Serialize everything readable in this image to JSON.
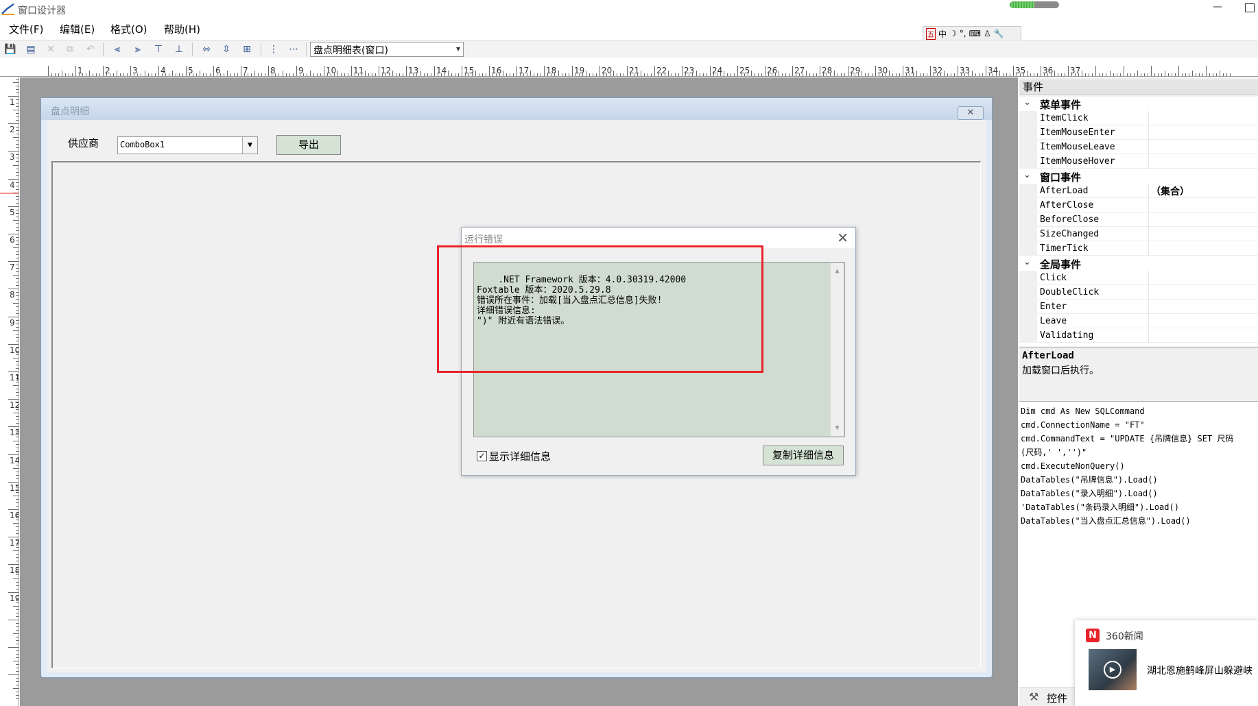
{
  "app": {
    "title": "窗口设计器"
  },
  "menu": [
    "文件(F)",
    "编辑(E)",
    "格式(O)",
    "帮助(H)"
  ],
  "ime": [
    "五",
    "中",
    "☽",
    "°,",
    "⌨",
    "♙",
    "🔧"
  ],
  "toolbar": {
    "form_select_value": "盘点明细表(窗口)"
  },
  "ruler": {
    "h_labels": [
      "1",
      "2",
      "3",
      "4",
      "5",
      "6",
      "7",
      "8",
      "9",
      "10",
      "11",
      "12",
      "13",
      "14",
      "15",
      "16",
      "17",
      "18",
      "19",
      "20",
      "21",
      "22",
      "23",
      "24",
      "25",
      "26",
      "27",
      "28",
      "29",
      "30",
      "31",
      "32",
      "33",
      "34",
      "35",
      "36",
      "37"
    ],
    "v_labels": [
      "1",
      "2",
      "3",
      "4",
      "5",
      "6",
      "7",
      "8",
      "9",
      "10",
      "11",
      "12",
      "13",
      "14",
      "15",
      "16",
      "17",
      "18",
      "19"
    ]
  },
  "design_form": {
    "caption": "盘点明细",
    "close_glyph": "✕",
    "supplier_label": "供应商",
    "combo_value": "ComboBox1",
    "export_label": "导出"
  },
  "error_dialog": {
    "title": "运行错误",
    "close_glyph": "✕",
    "details": ".NET Framework 版本：4.0.30319.42000\nFoxtable 版本：2020.5.29.8\n错误所在事件：加载[当入盘点汇总信息]失败!\n详细错误信息:\n\")\" 附近有语法错误。",
    "show_detail_label": "显示详细信息",
    "show_detail_checked": true,
    "copy_label": "复制详细信息"
  },
  "events_panel": {
    "header": "事件",
    "groups": [
      {
        "name": "菜单事件",
        "items": [
          {
            "name": "ItemClick",
            "value": ""
          },
          {
            "name": "ItemMouseEnter",
            "value": ""
          },
          {
            "name": "ItemMouseLeave",
            "value": ""
          },
          {
            "name": "ItemMouseHover",
            "value": ""
          }
        ]
      },
      {
        "name": "窗口事件",
        "items": [
          {
            "name": "AfterLoad",
            "value": "（集合）"
          },
          {
            "name": "AfterClose",
            "value": ""
          },
          {
            "name": "BeforeClose",
            "value": ""
          },
          {
            "name": "SizeChanged",
            "value": ""
          },
          {
            "name": "TimerTick",
            "value": ""
          }
        ]
      },
      {
        "name": "全局事件",
        "items": [
          {
            "name": "Click",
            "value": ""
          },
          {
            "name": "DoubleClick",
            "value": ""
          },
          {
            "name": "Enter",
            "value": ""
          },
          {
            "name": "Leave",
            "value": ""
          },
          {
            "name": "Validating",
            "value": ""
          }
        ]
      }
    ],
    "desc_title": "AfterLoad",
    "desc_text": "加载窗口后执行。",
    "code": "Dim cmd As New SQLCommand\ncmd.ConnectionName = \"FT\"\ncmd.CommandText = \"UPDATE {吊牌信息} SET 尺码\n(尺码,' ','')\"\ncmd.ExecuteNonQuery()\nDataTables(\"吊牌信息\").Load()\nDataTables(\"录入明细\").Load()\n'DataTables(\"条码录入明细\").Load()\nDataTables(\"当入盘点汇总信息\").Load()",
    "controls_tab": "控件"
  },
  "news": {
    "source": "360新闻",
    "logo": "N",
    "headline": "湖北恩施鹤峰屏山躲避峡"
  }
}
